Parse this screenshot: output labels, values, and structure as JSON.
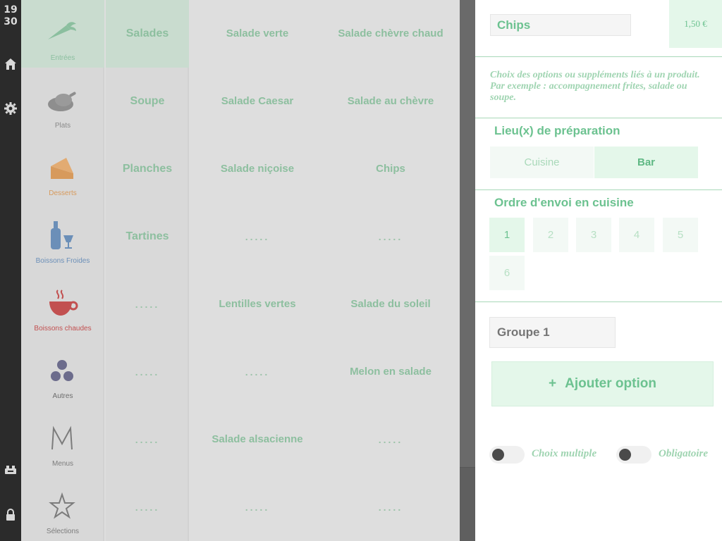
{
  "clock": {
    "hours": "19",
    "minutes": "30"
  },
  "rail": {
    "icons": [
      "home-icon",
      "gear-icon",
      "cash-register-icon",
      "lock-icon"
    ]
  },
  "categories": [
    {
      "label": "Entrées",
      "icon": "carrot-icon",
      "color": "#8bbf9f",
      "active": true
    },
    {
      "label": "Plats",
      "icon": "roast-chicken-icon",
      "color": "#8a8a8a"
    },
    {
      "label": "Desserts",
      "icon": "cake-slice-icon",
      "color": "#d79a5c"
    },
    {
      "label": "Boissons Froides",
      "icon": "bottle-glass-icon",
      "color": "#6b8fb8"
    },
    {
      "label": "Boissons chaudes",
      "icon": "hot-cup-icon",
      "color": "#c25050"
    },
    {
      "label": "Autres",
      "icon": "three-dots-icon",
      "color": "#6c6c8c"
    },
    {
      "label": "Menus",
      "icon": "letter-m-icon",
      "color": "#7c7c7c"
    },
    {
      "label": "Sélections",
      "icon": "star-icon",
      "color": "#7c7c7c"
    }
  ],
  "subcategories": [
    "Salades",
    "Soupe",
    "Planches",
    "Tartines",
    ".....",
    ".....",
    ".....",
    "....."
  ],
  "products": [
    [
      "Salade verte",
      "Salade chèvre chaud"
    ],
    [
      "Salade Caesar",
      "Salade au chèvre"
    ],
    [
      "Salade niçoise",
      "Chips"
    ],
    [
      ".....",
      "....."
    ],
    [
      "Lentilles vertes",
      "Salade du soleil"
    ],
    [
      ".....",
      "Melon en salade"
    ],
    [
      "Salade alsacienne",
      "....."
    ],
    [
      ".....",
      "....."
    ]
  ],
  "editor": {
    "name": "Chips",
    "price": "1,50 €",
    "description": "Choix des options ou suppléments liés à un produit. Par exemple : accompagnement frites, salade ou soupe.",
    "prep_title": "Lieu(x) de préparation",
    "prep_options": [
      "Cuisine",
      "Bar"
    ],
    "prep_selected": "Bar",
    "order_title": "Ordre d'envoi en cuisine",
    "order_options": [
      "1",
      "2",
      "3",
      "4",
      "5",
      "6"
    ],
    "order_selected": "1",
    "group_placeholder": "Groupe 1",
    "add_option_label": "Ajouter option",
    "add_option_icon": "plus-icon",
    "toggle_multiple_label": "Choix multiple",
    "toggle_required_label": "Obligatoire"
  },
  "colors": {
    "accent": "#6cc290",
    "accent_light": "#e4f7ea",
    "rail": "#2b2b2b"
  }
}
